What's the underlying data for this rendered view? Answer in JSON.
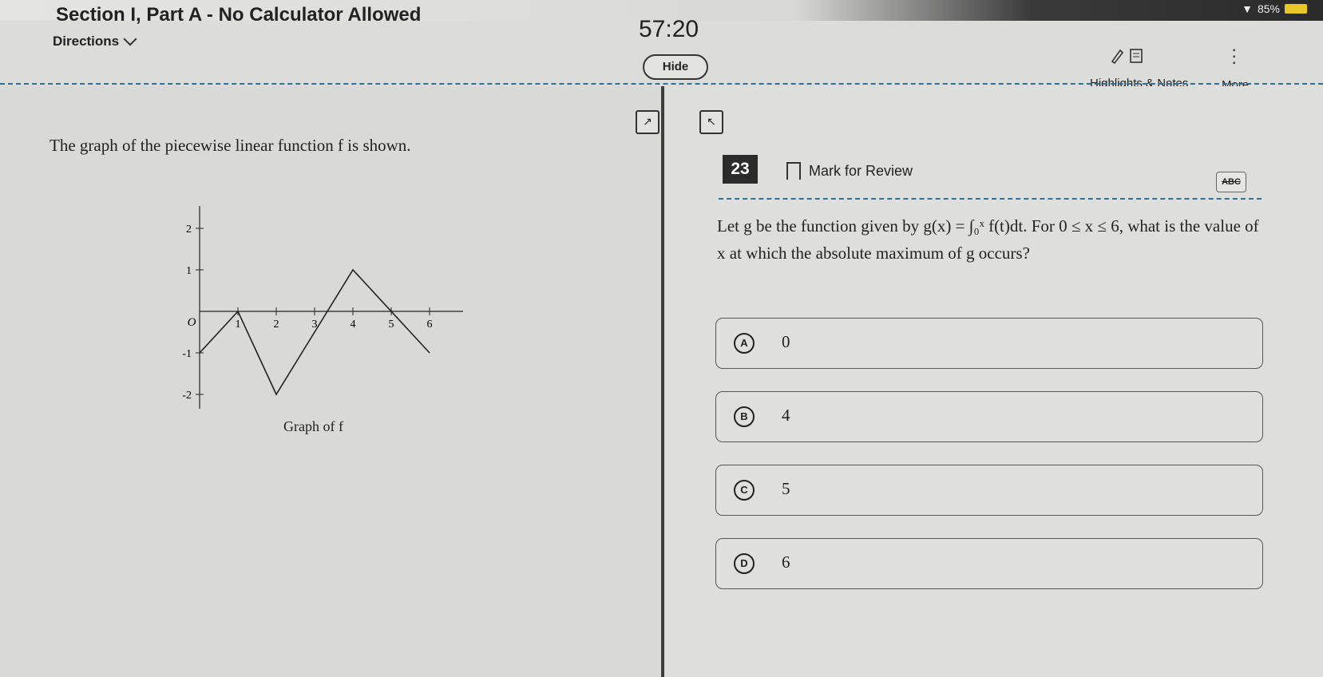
{
  "status": {
    "battery": "85%"
  },
  "header": {
    "section_title": "Section I, Part A - No Calculator Allowed",
    "directions_label": "Directions",
    "timer": "57:20",
    "hide_label": "Hide",
    "highlights_label": "Highlights & Notes",
    "more_label": "More"
  },
  "left": {
    "prompt": "The graph of the piecewise linear function f is shown.",
    "graph_caption": "Graph of f",
    "graph_y_ticks": [
      "2",
      "1",
      "-1",
      "-2"
    ],
    "graph_x_ticks": [
      "1",
      "2",
      "3",
      "4",
      "5",
      "6"
    ],
    "graph_origin_label": "O"
  },
  "question": {
    "number": "23",
    "mark_review_label": "Mark for Review",
    "abc_label": "ABC",
    "text": "Let g be the function given by g(x) = ∫₀ˣ f(t)dt. For 0 ≤ x ≤ 6, what is the value of x at which the absolute maximum of g occurs?"
  },
  "choices": [
    {
      "letter": "A",
      "value": "0"
    },
    {
      "letter": "B",
      "value": "4"
    },
    {
      "letter": "C",
      "value": "5"
    },
    {
      "letter": "D",
      "value": "6"
    }
  ],
  "chart_data": {
    "type": "line",
    "x": [
      0,
      1,
      2,
      4,
      6
    ],
    "series": [
      {
        "values": [
          -1,
          0,
          -2,
          1,
          -1
        ]
      }
    ],
    "xlim": [
      0,
      6
    ],
    "ylim": [
      -2,
      2
    ],
    "title": "Graph of f"
  }
}
